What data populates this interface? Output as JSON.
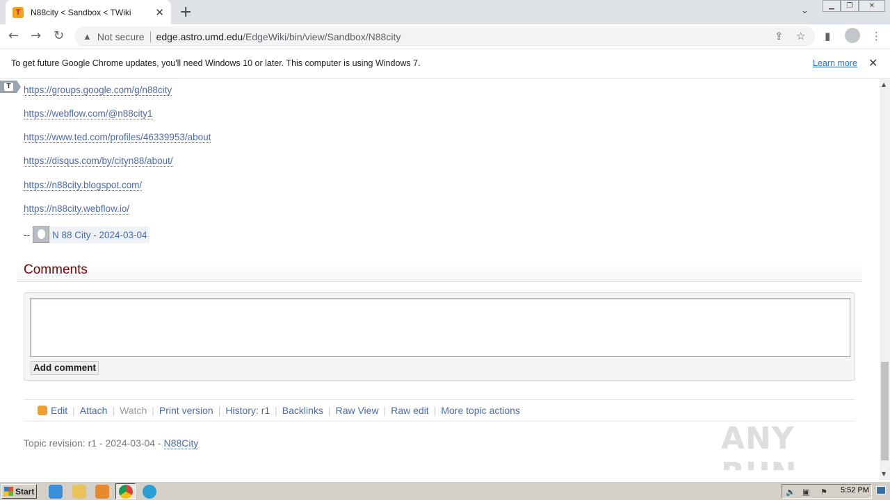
{
  "browser": {
    "tab_title": "N88city < Sandbox < TWiki",
    "favicon_letter": "T",
    "not_secure": "Not secure",
    "url_host": "edge.astro.umd.edu",
    "url_path": "/EdgeWiki/bin/view/Sandbox/N88city"
  },
  "infobar": {
    "text": "To get future Google Chrome updates, you'll need Windows 10 or later. This computer is using Windows 7.",
    "link": "Learn more"
  },
  "page": {
    "twiki_badge": "T",
    "links": [
      "https://groups.google.com/g/n88city",
      "https://webflow.com/@n88city1",
      "https://www.ted.com/profiles/46339953/about",
      "https://disqus.com/by/cityn88/about/",
      "https://n88city.blogspot.com/",
      "https://n88city.webflow.io/"
    ],
    "signature": {
      "dash": "--",
      "text": "N 88 City - 2024-03-04"
    },
    "comments_heading": "Comments",
    "add_comment_label": "Add comment",
    "actions": {
      "edit": "Edit",
      "attach": "Attach",
      "watch": "Watch",
      "print": "Print version",
      "history": "History:",
      "history_rev": "r1",
      "backlinks": "Backlinks",
      "raw_view": "Raw View",
      "raw_edit": "Raw edit",
      "more": "More topic actions"
    },
    "revision": {
      "text": "Topic revision: r1 - 2024-03-04 -",
      "author": "N88City"
    },
    "watermark": "ANY RUN"
  },
  "taskbar": {
    "start": "Start",
    "clock": "5:52 PM"
  },
  "colors": {
    "link": "#4a6ab2",
    "heading": "#7a0000",
    "chrome_link": "#1a73e8"
  }
}
